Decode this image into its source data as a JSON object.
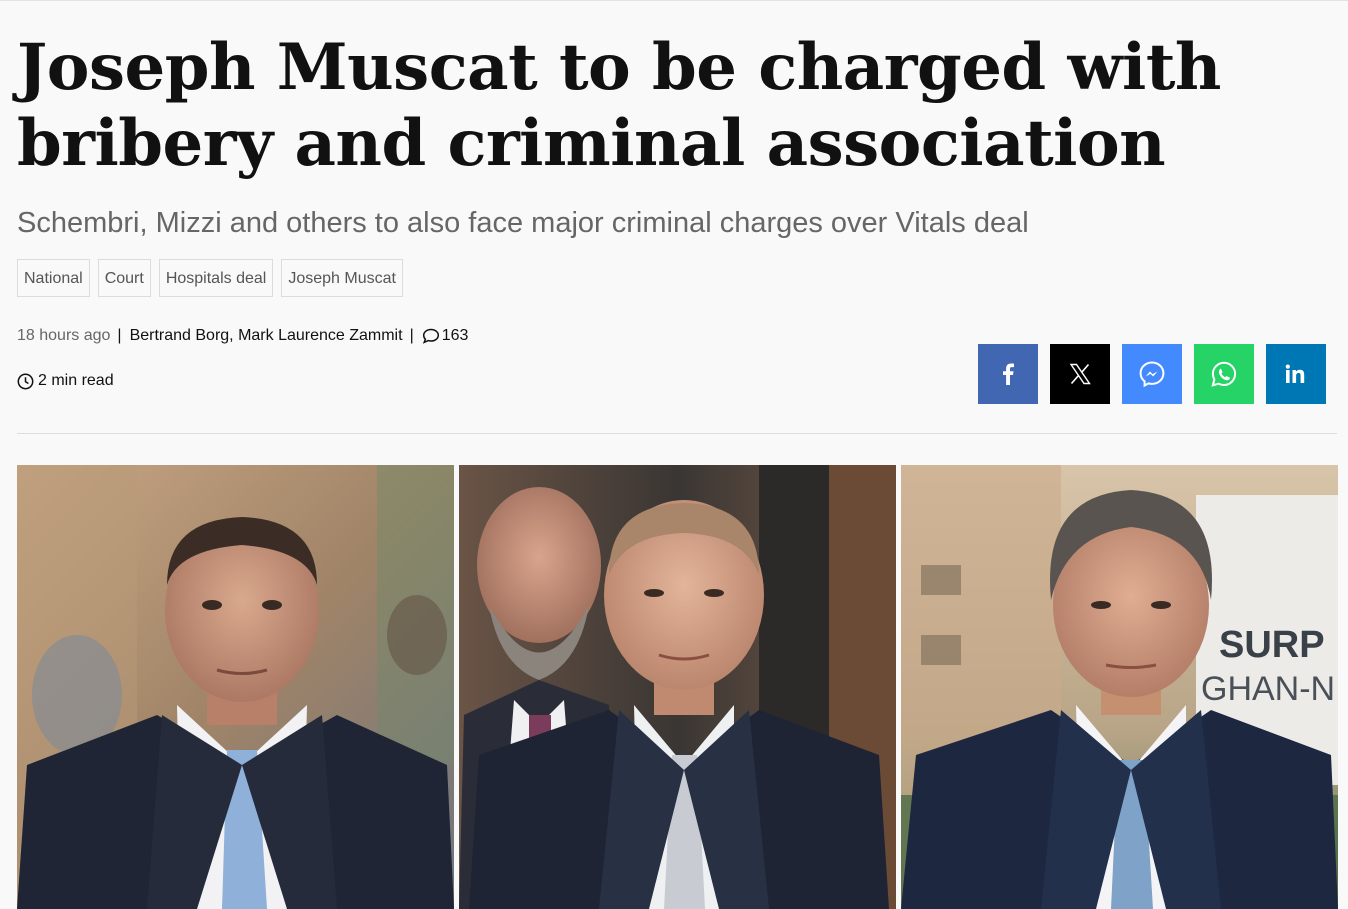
{
  "article": {
    "headline": "Joseph Muscat to be charged with bribery and criminal association",
    "subheadline": "Schembri, Mizzi and others to also face major criminal charges over Vitals deal",
    "tags": [
      "National",
      "Court",
      "Hospitals deal",
      "Joseph Muscat"
    ],
    "meta": {
      "time_ago": "18 hours ago",
      "separator": "|",
      "authors": "Bertrand Borg, Mark Laurence Zammit",
      "comment_count": "163",
      "read_time": "2 min read"
    }
  },
  "share": {
    "buttons": [
      {
        "name": "facebook",
        "icon": "facebook-icon",
        "color": "#4267b2"
      },
      {
        "name": "x",
        "icon": "x-icon",
        "color": "#000000"
      },
      {
        "name": "messenger",
        "icon": "messenger-icon",
        "color": "#448aff"
      },
      {
        "name": "whatsapp",
        "icon": "whatsapp-icon",
        "color": "#25d366"
      },
      {
        "name": "linkedin",
        "icon": "linkedin-icon",
        "color": "#0077b5"
      }
    ]
  },
  "hero_image": {
    "panels": [
      "man-in-suit-left",
      "man-in-suit-center",
      "man-in-suit-right"
    ],
    "sign_text": "SURP GHAN-N"
  }
}
